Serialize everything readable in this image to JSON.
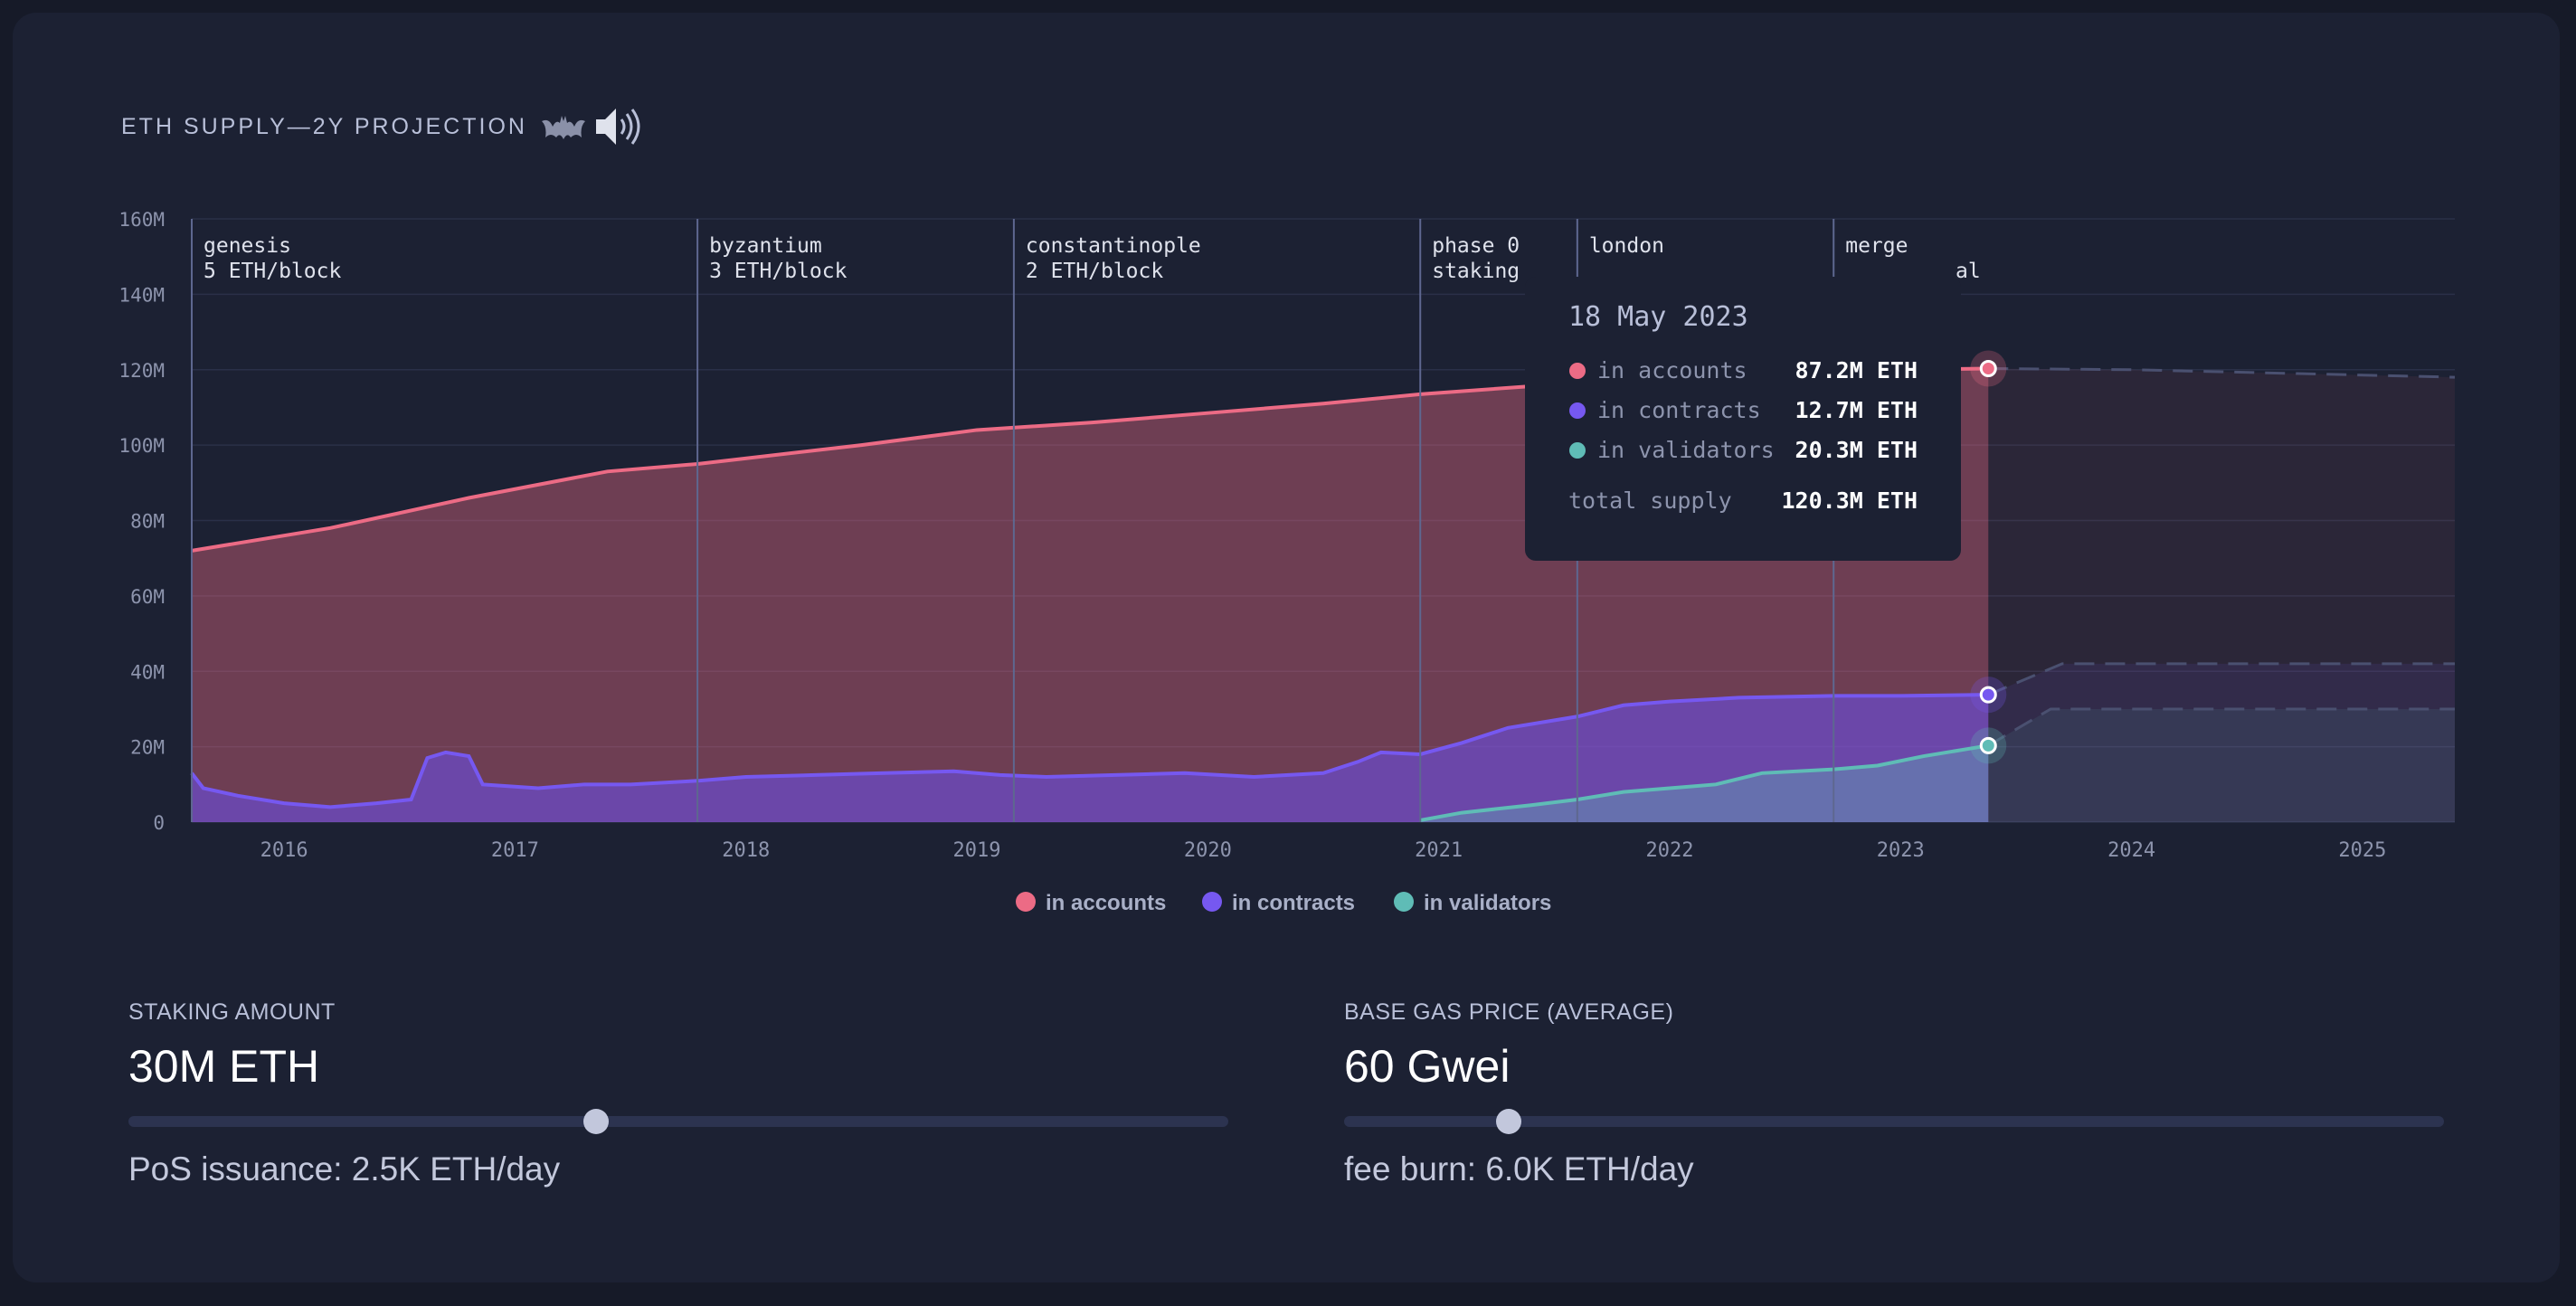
{
  "title": "ETH SUPPLY—2Y PROJECTION",
  "chart_data": {
    "type": "area",
    "x_ticks": [
      "2016",
      "2017",
      "2018",
      "2019",
      "2020",
      "2021",
      "2022",
      "2023",
      "2024",
      "2025"
    ],
    "y_ticks": [
      "0",
      "20M",
      "40M",
      "60M",
      "80M",
      "100M",
      "120M",
      "140M",
      "160M"
    ],
    "ylim": [
      0,
      160
    ],
    "xlim": [
      2015.6,
      2025.4
    ],
    "grid": true,
    "legend_position": "bottom",
    "phases": [
      {
        "name": "genesis",
        "sub": "5 ETH/block",
        "x": 2015.6
      },
      {
        "name": "byzantium",
        "sub": "3 ETH/block",
        "x": 2017.79
      },
      {
        "name": "constantinople",
        "sub": "2 ETH/block",
        "x": 2019.16
      },
      {
        "name": "phase 0",
        "sub": "staking",
        "x": 2020.92
      },
      {
        "name": "london",
        "sub": "",
        "x": 2021.6
      },
      {
        "name": "merge",
        "sub": "",
        "x": 2022.71
      }
    ],
    "phase_label_fragment": "al",
    "series": [
      {
        "name": "in accounts",
        "color": "#ec6b85",
        "data": [
          [
            2015.6,
            72
          ],
          [
            2016.2,
            78
          ],
          [
            2016.8,
            86
          ],
          [
            2017.4,
            93
          ],
          [
            2017.79,
            95
          ],
          [
            2018.5,
            100
          ],
          [
            2019.0,
            104
          ],
          [
            2019.5,
            106
          ],
          [
            2020.0,
            108.5
          ],
          [
            2020.5,
            111
          ],
          [
            2020.92,
            113.5
          ],
          [
            2021.6,
            116.5
          ],
          [
            2022.0,
            117.2
          ],
          [
            2022.5,
            118.5
          ],
          [
            2022.71,
            119.5
          ],
          [
            2023.0,
            120
          ],
          [
            2023.38,
            120.3
          ]
        ],
        "projection": [
          [
            2023.38,
            120.3
          ],
          [
            2024.0,
            120
          ],
          [
            2025.4,
            118
          ]
        ]
      },
      {
        "name": "in contracts",
        "color": "#7658f0",
        "data": [
          [
            2015.6,
            13
          ],
          [
            2015.65,
            9
          ],
          [
            2015.8,
            7
          ],
          [
            2016.0,
            5
          ],
          [
            2016.2,
            4
          ],
          [
            2016.4,
            5
          ],
          [
            2016.55,
            6
          ],
          [
            2016.62,
            17
          ],
          [
            2016.7,
            18.5
          ],
          [
            2016.8,
            17.5
          ],
          [
            2016.86,
            10
          ],
          [
            2017.1,
            9
          ],
          [
            2017.3,
            10
          ],
          [
            2017.5,
            10
          ],
          [
            2017.8,
            11
          ],
          [
            2018.0,
            12
          ],
          [
            2018.3,
            12.5
          ],
          [
            2018.6,
            13
          ],
          [
            2018.9,
            13.5
          ],
          [
            2019.1,
            12.5
          ],
          [
            2019.3,
            12
          ],
          [
            2019.6,
            12.5
          ],
          [
            2019.9,
            13
          ],
          [
            2020.2,
            12
          ],
          [
            2020.5,
            13
          ],
          [
            2020.65,
            16
          ],
          [
            2020.75,
            18.5
          ],
          [
            2020.92,
            18
          ],
          [
            2021.1,
            21
          ],
          [
            2021.3,
            25
          ],
          [
            2021.6,
            28
          ],
          [
            2021.8,
            31
          ],
          [
            2022.0,
            32
          ],
          [
            2022.3,
            33
          ],
          [
            2022.71,
            33.5
          ],
          [
            2023.0,
            33.5
          ],
          [
            2023.38,
            33.8
          ]
        ],
        "projection": [
          [
            2023.38,
            33.8
          ],
          [
            2023.7,
            42
          ],
          [
            2025.4,
            42
          ]
        ]
      },
      {
        "name": "in validators",
        "color": "#5fbcb6",
        "data": [
          [
            2020.92,
            0.5
          ],
          [
            2021.1,
            2.5
          ],
          [
            2021.4,
            4.5
          ],
          [
            2021.6,
            6
          ],
          [
            2021.8,
            8
          ],
          [
            2022.0,
            9
          ],
          [
            2022.2,
            10
          ],
          [
            2022.4,
            13
          ],
          [
            2022.71,
            14
          ],
          [
            2022.9,
            15
          ],
          [
            2023.1,
            17.5
          ],
          [
            2023.3,
            19.5
          ],
          [
            2023.38,
            20.3
          ]
        ],
        "projection": [
          [
            2023.38,
            20.3
          ],
          [
            2023.65,
            30
          ],
          [
            2025.4,
            30
          ]
        ]
      }
    ],
    "tooltip": {
      "date": "18 May 2023",
      "rows": [
        {
          "label": "in accounts",
          "value": "87.2M ETH",
          "color": "#ec6b85"
        },
        {
          "label": "in contracts",
          "value": "12.7M ETH",
          "color": "#7658f0"
        },
        {
          "label": "in validators",
          "value": "20.3M ETH",
          "color": "#5fbcb6"
        }
      ],
      "total_label": "total supply",
      "total_value": "120.3M ETH"
    }
  },
  "controls": {
    "staking": {
      "label": "STAKING AMOUNT",
      "value": "30M ETH",
      "sub": "PoS issuance: 2.5K ETH/day",
      "level": 0.425
    },
    "gas": {
      "label": "BASE GAS PRICE (AVERAGE)",
      "value": "60 Gwei",
      "sub": "fee burn: 6.0K ETH/day",
      "level": 0.15
    }
  }
}
